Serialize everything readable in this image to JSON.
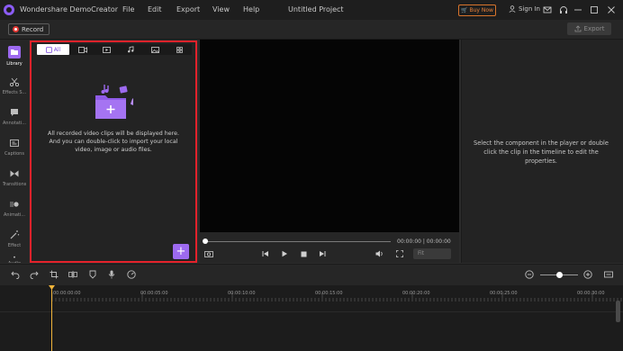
{
  "app": {
    "title": "Wondershare DemoCreator",
    "menu": [
      "File",
      "Edit",
      "Export",
      "View",
      "Help"
    ],
    "project_title": "Untitled Project",
    "buy_now": "Buy Now",
    "sign_in": "Sign In"
  },
  "toolbar": {
    "record_label": "Record",
    "export_label": "Export"
  },
  "sidebar": {
    "items": [
      {
        "label": "Library",
        "icon": "folder-icon",
        "active": true
      },
      {
        "label": "Effects S...",
        "icon": "scissors-icon"
      },
      {
        "label": "Annotati...",
        "icon": "speech-bubble-icon"
      },
      {
        "label": "Captions",
        "icon": "captions-icon"
      },
      {
        "label": "Transitions",
        "icon": "transition-icon"
      },
      {
        "label": "Animati...",
        "icon": "animation-icon"
      },
      {
        "label": "Effect",
        "icon": "magic-wand-icon"
      },
      {
        "label": "Audio",
        "icon": "audio-icon"
      }
    ]
  },
  "library": {
    "tabs": [
      "All",
      "video-icon",
      "screen-icon",
      "audio-icon",
      "image-icon",
      "grid-icon"
    ],
    "active_tab_label": "All",
    "empty_message": "All recorded video clips will be displayed here. And you can double-click to import your local video, image or audio files.",
    "add_label": "+"
  },
  "player": {
    "time": "00:00:00 | 00:00:00",
    "fit_label": "Fit"
  },
  "properties": {
    "hint": "Select the component in the player or double click the clip in the timeline to edit the properties."
  },
  "timeline": {
    "ticks": [
      "00:00:00:00",
      "00:00:05:00",
      "00:00:10:00",
      "00:00:15:00",
      "00:00:20:00",
      "00:00:25:00",
      "00:00:30:00"
    ]
  },
  "colors": {
    "accent": "#9d6af0",
    "highlight": "#e5222b",
    "buy_now": "#e8813a",
    "playhead": "#f1b43a"
  }
}
